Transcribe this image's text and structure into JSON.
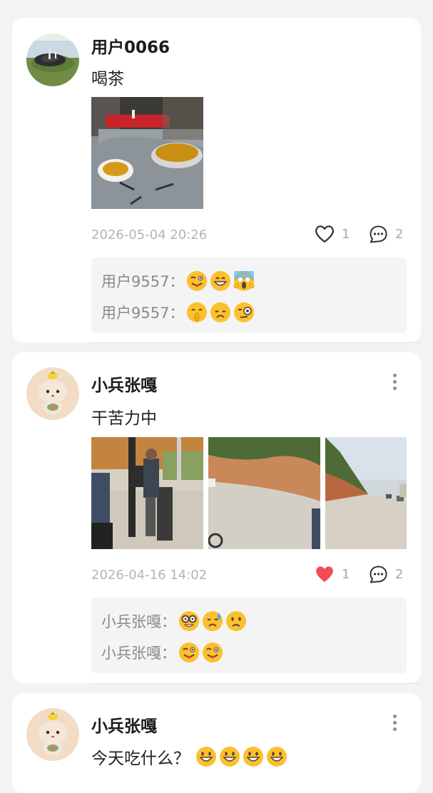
{
  "posts": [
    {
      "username": "用户0066",
      "content": "喝茶",
      "time": "2026-05-04 20:26",
      "likes": "1",
      "comments_count": "2",
      "liked": false,
      "comments": [
        {
          "author": "用户9557：",
          "emojis": [
            "wink-tongue-emoji",
            "grin-emoji",
            "scream-emoji"
          ]
        },
        {
          "author": "用户9557：",
          "emojis": [
            "shush-emoji",
            "disappointed-emoji",
            "monocle-emoji"
          ]
        }
      ]
    },
    {
      "username": "小兵张嘎",
      "content": "干苦力中",
      "time": "2026-04-16 14:02",
      "likes": "1",
      "comments_count": "2",
      "liked": true,
      "comments": [
        {
          "author": "小兵张嘎：",
          "emojis": [
            "nerd-emoji",
            "sad-sweat-emoji",
            "slight-frown-emoji"
          ]
        },
        {
          "author": "小兵张嘎：",
          "emojis": [
            "wink-tongue-emoji",
            "wink-tongue-emoji"
          ]
        }
      ]
    },
    {
      "username": "小兵张嘎",
      "content": "今天吃什么？"
    }
  ],
  "colors": {
    "like_active": "#f04b57",
    "meta_text": "#b4b4b4",
    "comment_bg": "#f4f4f4"
  }
}
